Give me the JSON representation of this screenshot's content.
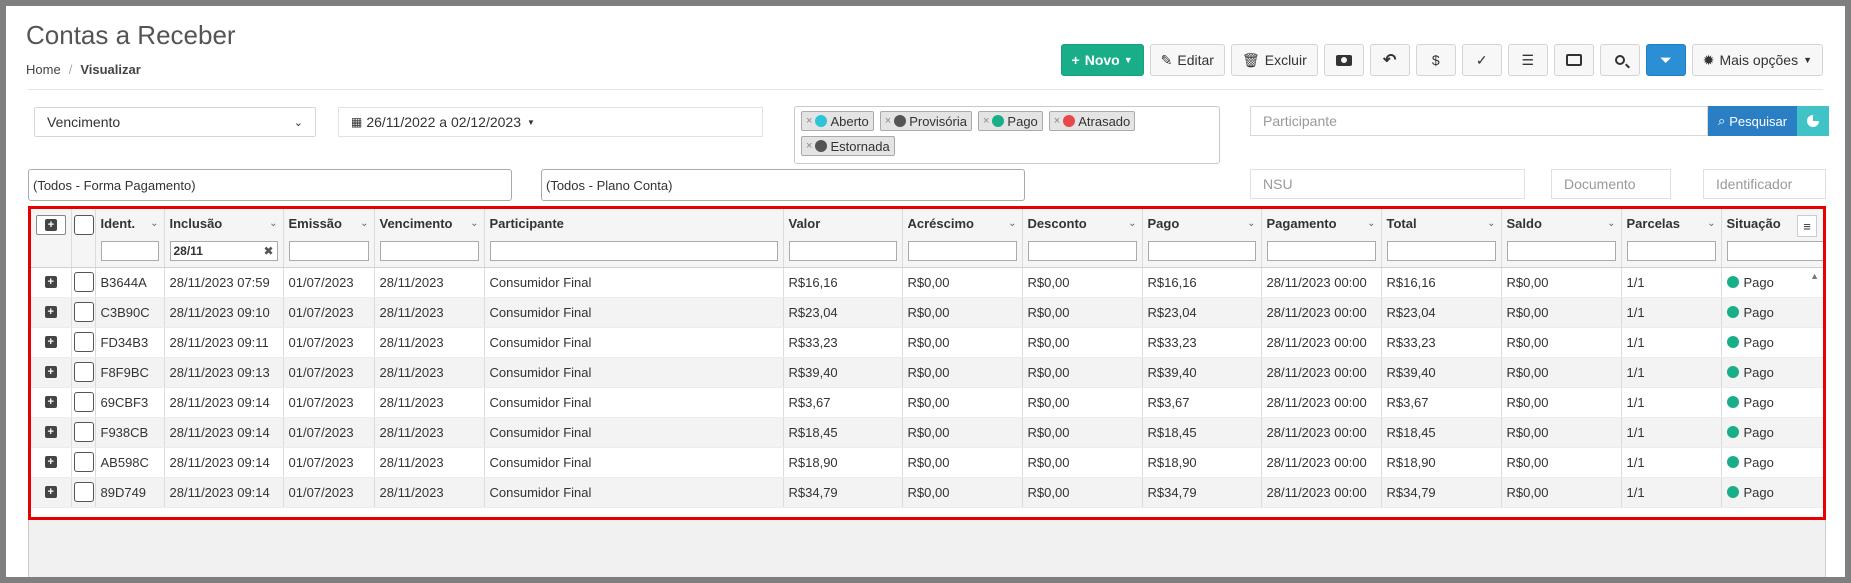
{
  "page": {
    "title": "Contas a Receber",
    "breadcrumb": {
      "home": "Home",
      "separator": "/",
      "current": "Visualizar"
    }
  },
  "toolbar": {
    "novo": "Novo",
    "editar": "Editar",
    "excluir": "Excluir",
    "mais_opcoes": "Mais opções"
  },
  "filters": {
    "date_field": "Vencimento",
    "date_range": "26/11/2022 a 02/12/2023",
    "status_tags": [
      {
        "label": "Aberto",
        "color": "#2ec4d6"
      },
      {
        "label": "Provisória",
        "color": "#555555"
      },
      {
        "label": "Pago",
        "color": "#1aae88"
      },
      {
        "label": "Atrasado",
        "color": "#e5484d"
      },
      {
        "label": "Estornada",
        "color": "#555555"
      }
    ],
    "participant_placeholder": "Participante",
    "search_label": "Pesquisar",
    "forma_pagamento": "(Todos - Forma Pagamento)",
    "plano_conta": "(Todos - Plano Conta)",
    "nsu_placeholder": "NSU",
    "documento_placeholder": "Documento",
    "identificador_placeholder": "Identificador"
  },
  "grid": {
    "columns": [
      "Ident.",
      "Inclusão",
      "Emissão",
      "Vencimento",
      "Participante",
      "Valor",
      "Acréscimo",
      "Desconto",
      "Pago",
      "Pagamento",
      "Total",
      "Saldo",
      "Parcelas",
      "Situação"
    ],
    "inclusao_filter": "28/11",
    "rows": [
      [
        "B3644A",
        "28/11/2023 07:59",
        "01/07/2023",
        "28/11/2023",
        "Consumidor Final",
        "R$16,16",
        "R$0,00",
        "R$0,00",
        "R$16,16",
        "28/11/2023 00:00",
        "R$16,16",
        "R$0,00",
        "1/1",
        "Pago"
      ],
      [
        "C3B90C",
        "28/11/2023 09:10",
        "01/07/2023",
        "28/11/2023",
        "Consumidor Final",
        "R$23,04",
        "R$0,00",
        "R$0,00",
        "R$23,04",
        "28/11/2023 00:00",
        "R$23,04",
        "R$0,00",
        "1/1",
        "Pago"
      ],
      [
        "FD34B3",
        "28/11/2023 09:11",
        "01/07/2023",
        "28/11/2023",
        "Consumidor Final",
        "R$33,23",
        "R$0,00",
        "R$0,00",
        "R$33,23",
        "28/11/2023 00:00",
        "R$33,23",
        "R$0,00",
        "1/1",
        "Pago"
      ],
      [
        "F8F9BC",
        "28/11/2023 09:13",
        "01/07/2023",
        "28/11/2023",
        "Consumidor Final",
        "R$39,40",
        "R$0,00",
        "R$0,00",
        "R$39,40",
        "28/11/2023 00:00",
        "R$39,40",
        "R$0,00",
        "1/1",
        "Pago"
      ],
      [
        "69CBF3",
        "28/11/2023 09:14",
        "01/07/2023",
        "28/11/2023",
        "Consumidor Final",
        "R$3,67",
        "R$0,00",
        "R$0,00",
        "R$3,67",
        "28/11/2023 00:00",
        "R$3,67",
        "R$0,00",
        "1/1",
        "Pago"
      ],
      [
        "F938CB",
        "28/11/2023 09:14",
        "01/07/2023",
        "28/11/2023",
        "Consumidor Final",
        "R$18,45",
        "R$0,00",
        "R$0,00",
        "R$18,45",
        "28/11/2023 00:00",
        "R$18,45",
        "R$0,00",
        "1/1",
        "Pago"
      ],
      [
        "AB598C",
        "28/11/2023 09:14",
        "01/07/2023",
        "28/11/2023",
        "Consumidor Final",
        "R$18,90",
        "R$0,00",
        "R$0,00",
        "R$18,90",
        "28/11/2023 00:00",
        "R$18,90",
        "R$0,00",
        "1/1",
        "Pago"
      ],
      [
        "89D749",
        "28/11/2023 09:14",
        "01/07/2023",
        "28/11/2023",
        "Consumidor Final",
        "R$34,79",
        "R$0,00",
        "R$0,00",
        "R$34,79",
        "28/11/2023 00:00",
        "R$34,79",
        "R$0,00",
        "1/1",
        "Pago"
      ]
    ]
  }
}
